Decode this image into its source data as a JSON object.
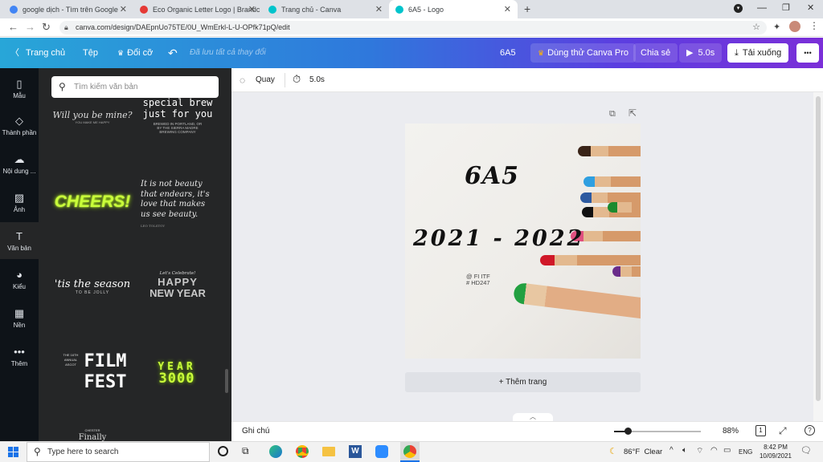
{
  "browser": {
    "tabs": [
      {
        "title": "google dịch - Tìm trên Google",
        "favicon_color": "#4285f4"
      },
      {
        "title": "Eco Organic Letter Logo | Brandc",
        "favicon_color": "#e53935"
      },
      {
        "title": "Trang chủ - Canva",
        "favicon_color": "#00c4cc"
      },
      {
        "title": "6A5 - Logo",
        "favicon_color": "#00c4cc"
      }
    ],
    "url": "canva.com/design/DAEpnUo75TE/0U_WmErkl-L-U-OPfk71pQ/edit"
  },
  "header": {
    "home": "Trang chủ",
    "file": "Tệp",
    "resize": "Đổi cỡ",
    "saved": "Đã lưu tất cả thay đổi",
    "doc_title": "6A5",
    "try_pro": "Dùng thử Canva Pro",
    "share": "Chia sẻ",
    "play": "5.0s",
    "download": "Tải xuống",
    "more": "•••"
  },
  "rail": [
    {
      "label": "Mẫu",
      "icon": "▯"
    },
    {
      "label": "Thành phần",
      "icon": "◇"
    },
    {
      "label": "Nội dung ...",
      "icon": "☁"
    },
    {
      "label": "Ảnh",
      "icon": "▨"
    },
    {
      "label": "Văn bản",
      "icon": "T"
    },
    {
      "label": "Kiểu",
      "icon": "◕"
    },
    {
      "label": "Nền",
      "icon": "▦"
    },
    {
      "label": "Thêm",
      "icon": "•••"
    }
  ],
  "panel": {
    "search_placeholder": "Tìm kiếm văn bản",
    "t1": "Will you be mine?",
    "t1_sub": "YOU MAKE ME HAPPY",
    "t2a": "special brew",
    "t2b": "just for you",
    "t2_sub1": "BREWED IN PORTLAND, OR",
    "t2_sub2": "BY THE SIERRA MADRE",
    "t2_sub3": "BREWING COMPANY",
    "t3": "CHEERS!",
    "t4a": "It is not beauty",
    "t4b": "that endears, it's",
    "t4c": "love that makes",
    "t4d": "us see beauty.",
    "t4_sub": "LEO TOLSTOY",
    "t5": "'tis the season",
    "t5_sub": "TO BE JOLLY",
    "t6_top": "Let's Celebrate!",
    "t6a": "HAPPY",
    "t6b": "NEW YEAR",
    "t7_small1": "THE 16TH",
    "t7_small2": "ANNUAL",
    "t7_small3": "ASCOT",
    "t7a": "FILM",
    "t7b": "FEST",
    "t8a": "YEAR",
    "t8b": "3000",
    "t9_small": "CHESTER",
    "t9": "Finally"
  },
  "toolbar": {
    "flip": "Quay",
    "duration": "5.0s"
  },
  "canvas": {
    "title": "6A5",
    "year": "2021 - 2022",
    "credit1": "@ FI ITF",
    "credit2": "# HD247",
    "add_page": "+ Thêm trang"
  },
  "bottom": {
    "notes": "Ghi chú",
    "zoom_pct": 88,
    "zoom_label": "88%",
    "page_num": "1"
  },
  "taskbar": {
    "search": "Type here to search",
    "weather": "86°F  Clear",
    "lang": "ENG",
    "time": "8:42 PM",
    "date": "10/09/2021"
  },
  "pencil_colors": [
    "#3a2418",
    "#2f9fe0",
    "#2c5aa0",
    "#111111",
    "#1b8a2e",
    "#e05080",
    "#d01828",
    "#6a2c8a",
    "#22a040"
  ]
}
